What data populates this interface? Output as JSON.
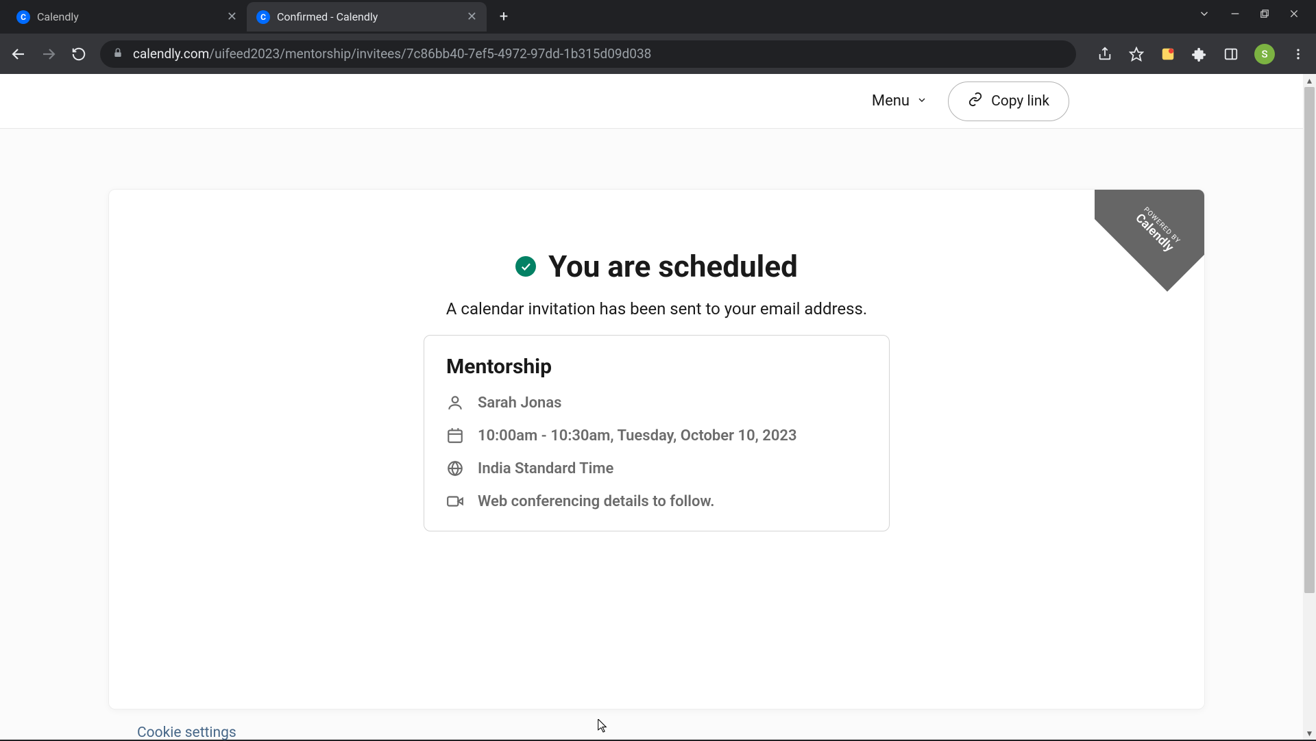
{
  "browser": {
    "tabs": [
      {
        "title": "Calendly",
        "active": false
      },
      {
        "title": "Confirmed - Calendly",
        "active": true
      }
    ],
    "url_host": "calendly.com",
    "url_path": "/uifeed2023/mentorship/invitees/7c86bb40-7ef5-4972-97dd-1b315d09d038",
    "avatar_letter": "S"
  },
  "header": {
    "menu_label": "Menu",
    "copy_link_label": "Copy link"
  },
  "badge": {
    "small": "POWERED BY",
    "big": "Calendly"
  },
  "confirmation": {
    "headline": "You are scheduled",
    "subline": "A calendar invitation has been sent to your email address.",
    "event_title": "Mentorship",
    "host": "Sarah Jonas",
    "datetime": "10:00am - 10:30am, Tuesday, October 10, 2023",
    "timezone": "India Standard Time",
    "location": "Web conferencing details to follow."
  },
  "footer": {
    "cookie_settings": "Cookie settings"
  }
}
